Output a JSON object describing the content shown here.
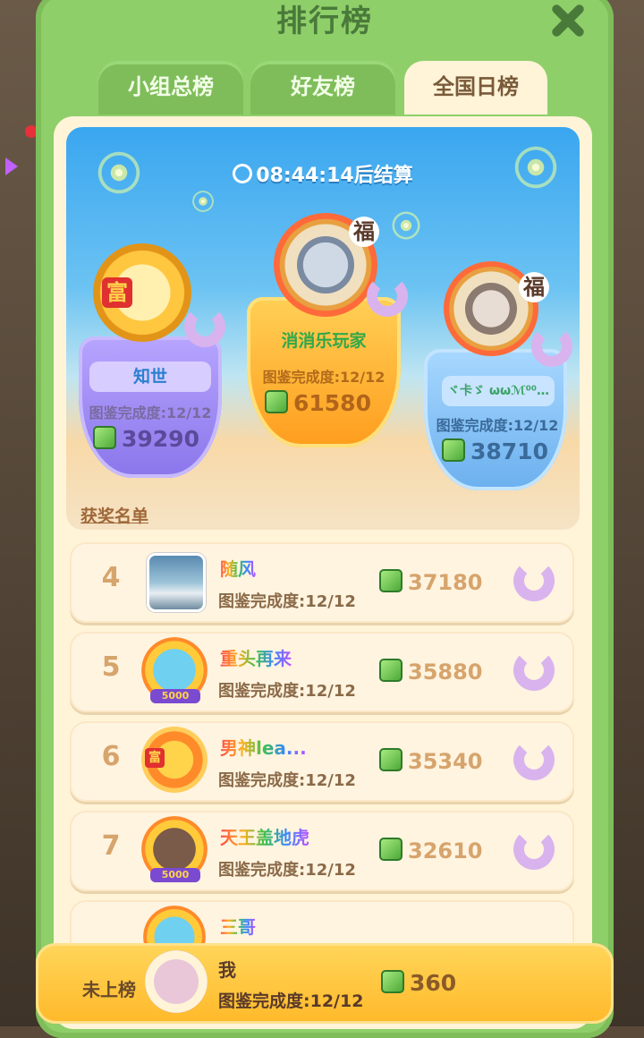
{
  "header": {
    "title": "排行榜"
  },
  "tabs": [
    {
      "label": "小组总榜",
      "active": false
    },
    {
      "label": "好友榜",
      "active": false
    },
    {
      "label": "全国日榜",
      "active": true
    }
  ],
  "timer": "08:44:14后结算",
  "podium": {
    "first": {
      "name": "消消乐玩家",
      "completion": "图鉴完成度:12/12",
      "score": "61580"
    },
    "second": {
      "name": "知世",
      "completion": "图鉴完成度:12/12",
      "score": "39290"
    },
    "third": {
      "name": "ヾ卡ゞ ωωℳ⁰⁰…",
      "completion": "图鉴完成度:12/12",
      "score": "38710"
    },
    "fu_glyph": "福",
    "fu_glyph2": "福",
    "frame_text": "富"
  },
  "awards_label": "获奖名单",
  "list": [
    {
      "rank": "4",
      "name": "随风",
      "completion": "图鉴完成度:12/12",
      "score": "37180"
    },
    {
      "rank": "5",
      "name": "重头再来",
      "completion": "图鉴完成度:12/12",
      "score": "35880",
      "badge": "5000"
    },
    {
      "rank": "6",
      "name": "男神lea...",
      "completion": "图鉴完成度:12/12",
      "score": "35340",
      "badge": "富"
    },
    {
      "rank": "7",
      "name": "天王盖地虎",
      "completion": "图鉴完成度:12/12",
      "score": "32610",
      "badge": "5000"
    },
    {
      "rank": "",
      "name": "三哥",
      "completion": "",
      "score": ""
    }
  ],
  "me": {
    "status": "未上榜",
    "name": "我",
    "completion": "图鉴完成度:12/12",
    "score": "360"
  },
  "colors": {
    "panel": "#8fcf6a",
    "board": "#fff4d8",
    "accent": "#ffb92a"
  }
}
